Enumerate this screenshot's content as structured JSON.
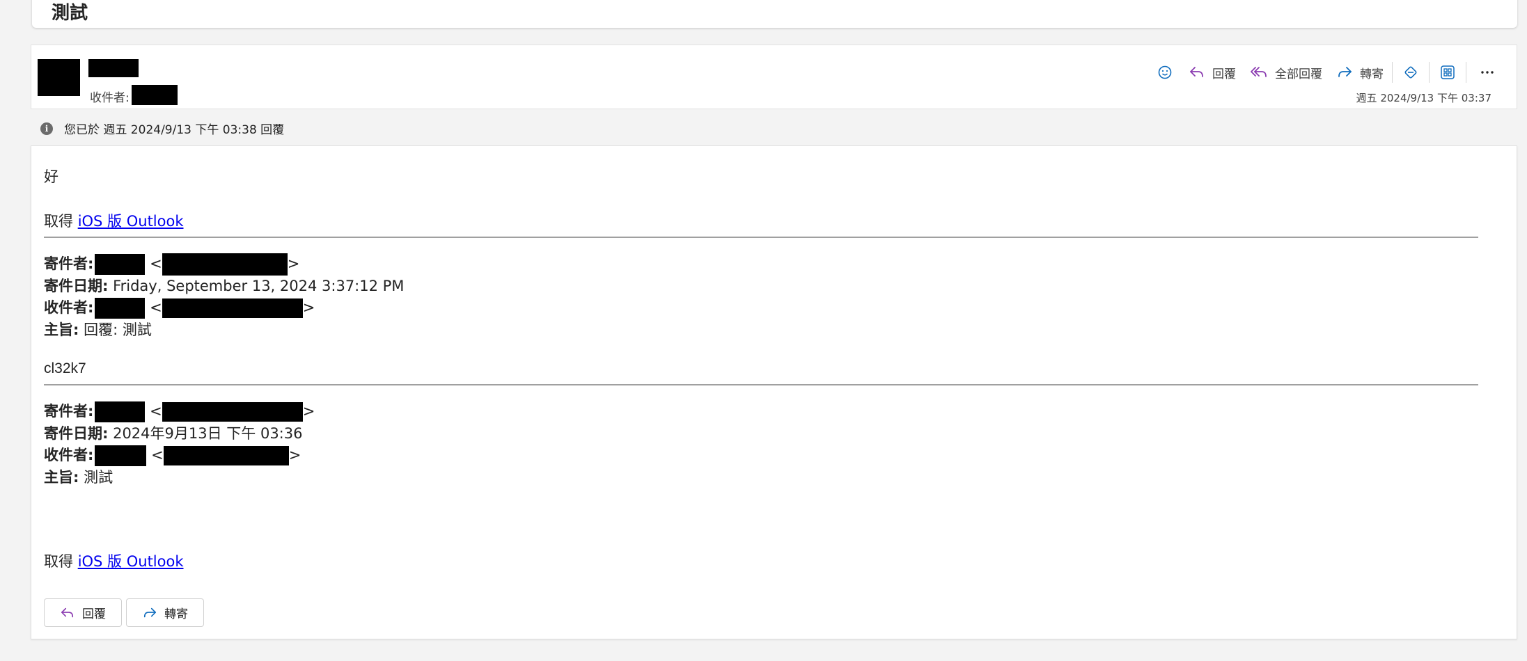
{
  "previous_card": {
    "subject": "測試"
  },
  "header": {
    "to_label": "收件者:",
    "date": "週五 2024/9/13 下午 03:37",
    "actions": {
      "reply": "回覆",
      "reply_all": "全部回覆",
      "forward": "轉寄"
    },
    "icons": [
      "emoji-icon",
      "reply-icon",
      "reply-all-icon",
      "forward-icon",
      "loop-icon",
      "apps-icon",
      "more-icon"
    ]
  },
  "info": {
    "text": "您已於 週五 2024/9/13 下午 03:38 回覆"
  },
  "body": {
    "greeting": "好",
    "get_prefix": "取得 ",
    "get_link": "iOS 版 Outlook",
    "quote1": {
      "from_label": "寄件者:",
      "sent_label": "寄件日期:",
      "sent_value": " Friday, September 13, 2024 3:37:12 PM",
      "to_label": "收件者:",
      "subject_label": "主旨:",
      "subject_value": " 回覆: 測試"
    },
    "code_text": "cl32k7",
    "quote2": {
      "from_label": "寄件者:",
      "sent_label": "寄件日期:",
      "sent_value": " 2024年9月13日 下午 03:36",
      "to_label": "收件者:",
      "subject_label": "主旨:",
      "subject_value": " 測試"
    },
    "footer_prefix": "取得 ",
    "footer_link": "iOS 版 Outlook"
  },
  "buttons": {
    "reply": "回覆",
    "forward": "轉寄"
  },
  "colors": {
    "accent_blue": "#0f6cbd",
    "reply_purple": "#8a3bb0",
    "link": "#0000ee"
  }
}
